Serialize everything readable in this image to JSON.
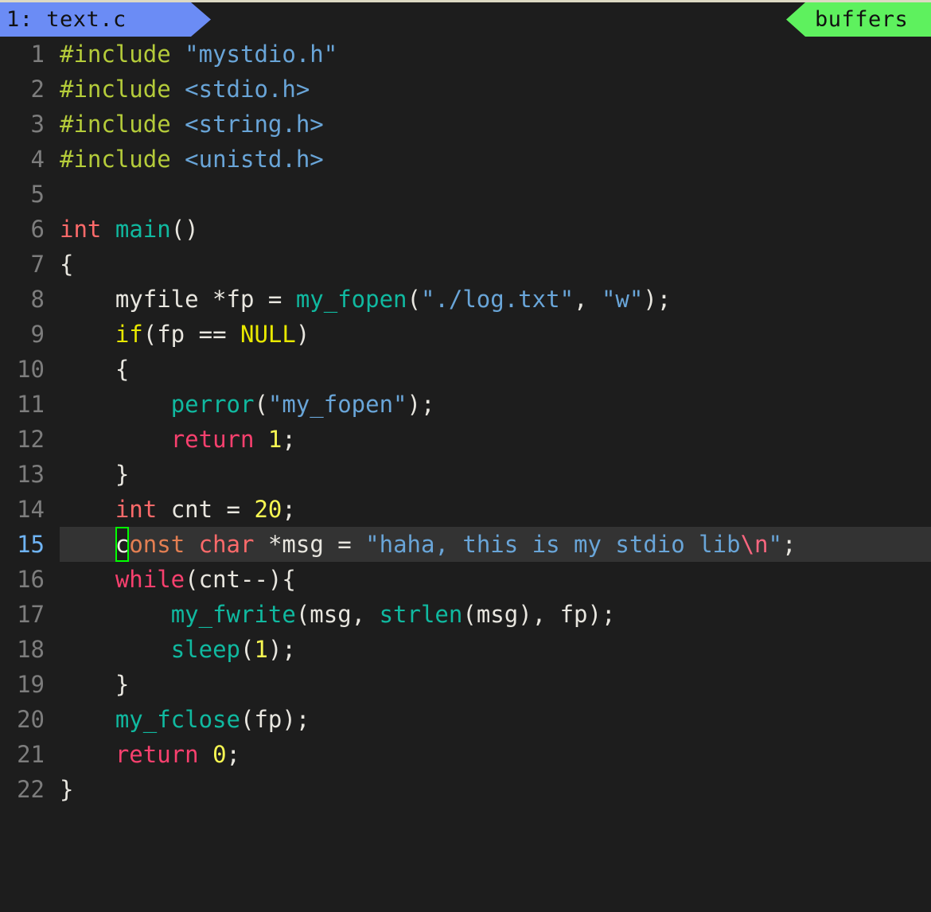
{
  "window": {
    "background": "#1d1d1d",
    "top_rule_color": "#ddd9c3"
  },
  "tabline": {
    "active_tab": {
      "label": "1: text.c",
      "index": "1",
      "filename": "text.c",
      "background": "#6b8cf5",
      "text_color": "#111111"
    },
    "buffers_tab": {
      "label": "buffers",
      "background": "#5ef15e",
      "text_color": "#111111"
    }
  },
  "editor": {
    "current_line": 15,
    "cursor": {
      "char": "c",
      "line": 15,
      "column": 5,
      "border_color": "#00ff00"
    },
    "highlight_color": "#333333",
    "lnum_color": "#7d7d7d",
    "lnum_current_color": "#6fb4f5",
    "lines": [
      {
        "n": "1",
        "text": "#include \"mystdio.h\""
      },
      {
        "n": "2",
        "text": "#include <stdio.h>"
      },
      {
        "n": "3",
        "text": "#include <string.h>"
      },
      {
        "n": "4",
        "text": "#include <unistd.h>"
      },
      {
        "n": "5",
        "text": ""
      },
      {
        "n": "6",
        "text": "int main()"
      },
      {
        "n": "7",
        "text": "{"
      },
      {
        "n": "8",
        "text": "    myfile *fp = my_fopen(\"./log.txt\", \"w\");"
      },
      {
        "n": "9",
        "text": "    if(fp == NULL)"
      },
      {
        "n": "10",
        "text": "    {"
      },
      {
        "n": "11",
        "text": "        perror(\"my_fopen\");"
      },
      {
        "n": "12",
        "text": "        return 1;"
      },
      {
        "n": "13",
        "text": "    }"
      },
      {
        "n": "14",
        "text": "    int cnt = 20;"
      },
      {
        "n": "15",
        "text": "    const char *msg = \"haha, this is my stdio lib\\n\";"
      },
      {
        "n": "16",
        "text": "    while(cnt--){"
      },
      {
        "n": "17",
        "text": "        my_fwrite(msg, strlen(msg), fp);"
      },
      {
        "n": "18",
        "text": "        sleep(1);"
      },
      {
        "n": "19",
        "text": "    }"
      },
      {
        "n": "20",
        "text": "    my_fclose(fp);"
      },
      {
        "n": "21",
        "text": "    return 0;"
      },
      {
        "n": "22",
        "text": "}"
      }
    ],
    "syntax_colors": {
      "preprocessor": "#b5cc3a",
      "string": "#69a5d8",
      "escape": "#f8667f",
      "type": "#fd6a6a",
      "const_qualifier": "#e37f52",
      "function": "#10b9a0",
      "keyword": "#f8406e",
      "conditional": "#e8e800",
      "number": "#f7f752",
      "normal": "#e8e6df"
    }
  }
}
